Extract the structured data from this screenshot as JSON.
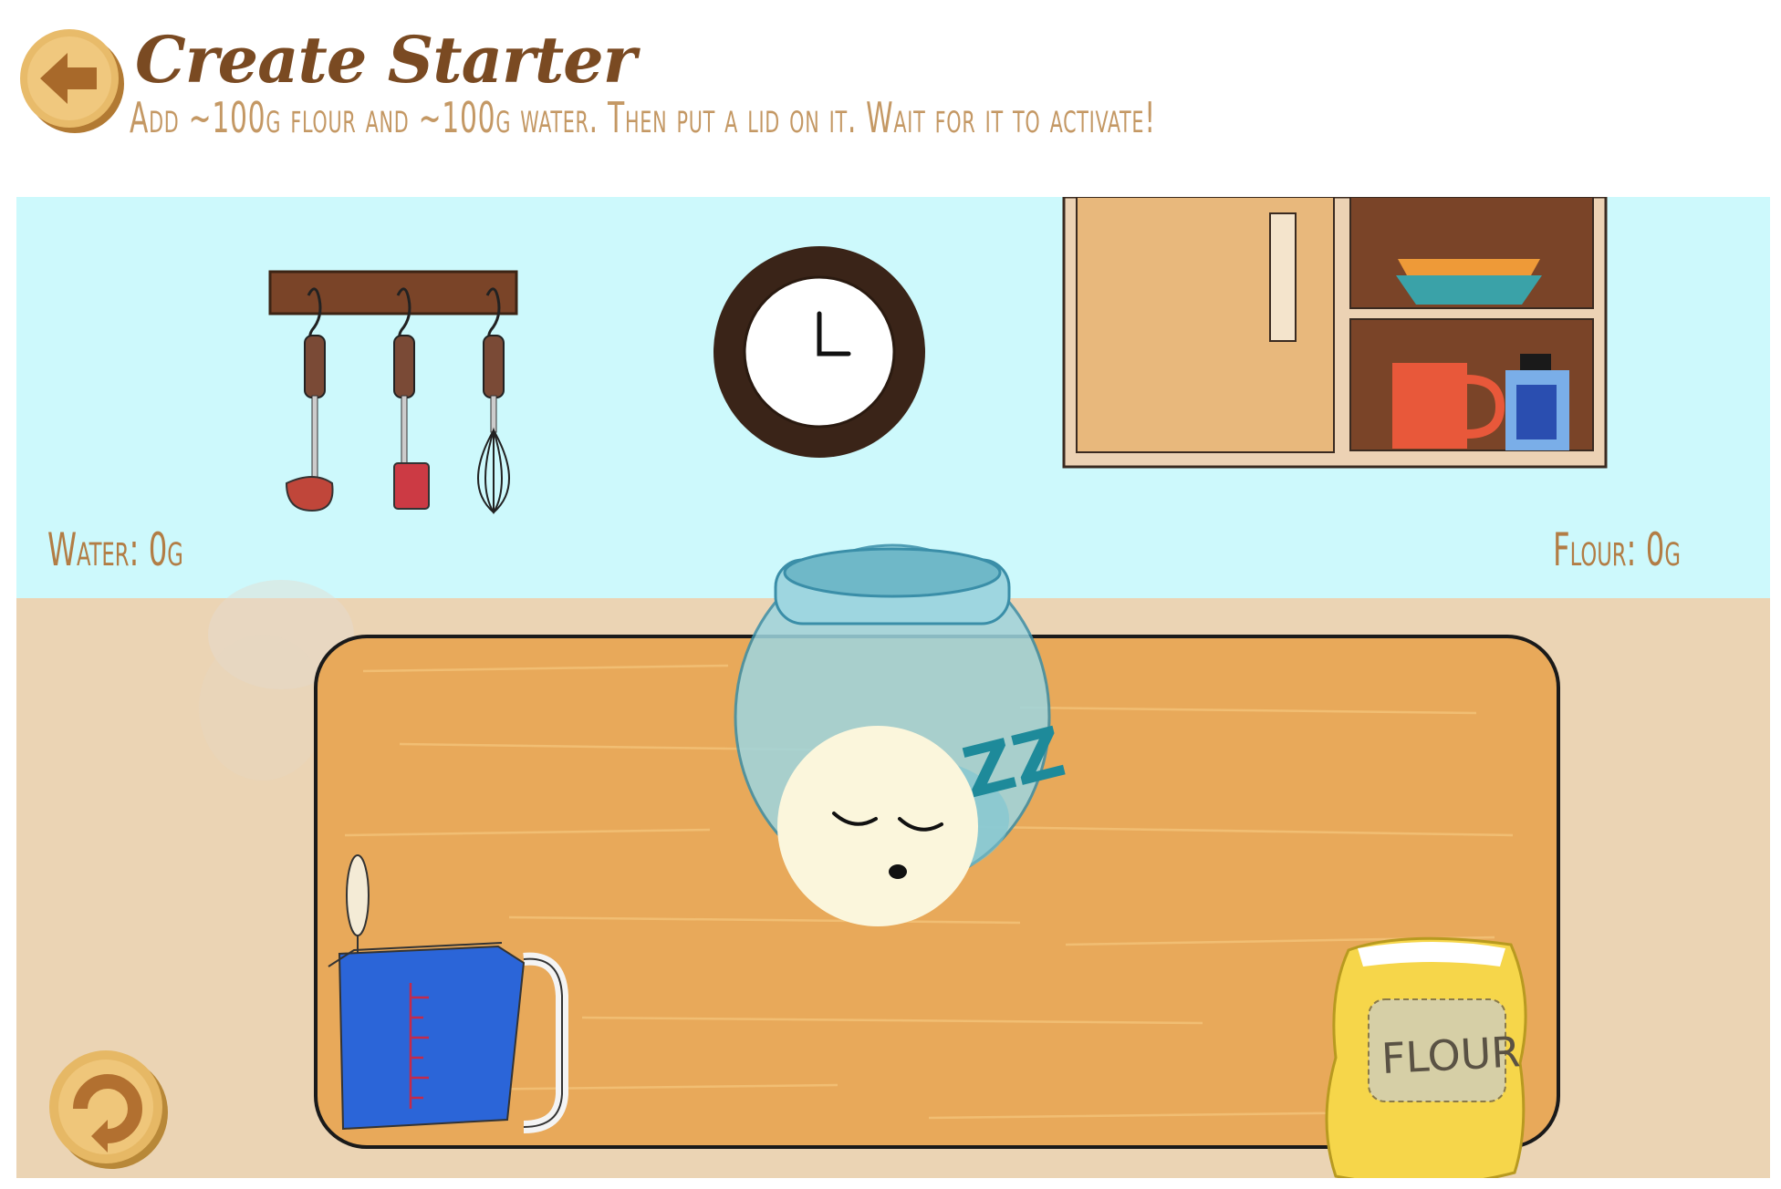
{
  "header": {
    "title": "Create Starter",
    "instructions": "Add ~100g flour and ~100g water. Then put a lid on it. Wait for it to activate!"
  },
  "readouts": {
    "water": "Water: 0g",
    "flour": "Flour: 0g"
  },
  "flour_bag": {
    "label": "FLOUR"
  },
  "starter": {
    "sleep_text": "ZZ"
  },
  "icons": {
    "back": "arrow-left-icon",
    "reset": "circular-arrow-icon"
  },
  "colors": {
    "wall": "#cdf9fc",
    "floor": "#ebd4b4",
    "table": "#e8a95a",
    "title": "#7a4a22",
    "subtitle": "#c49864",
    "button": "#e6b865",
    "water": "#2b65d8"
  }
}
